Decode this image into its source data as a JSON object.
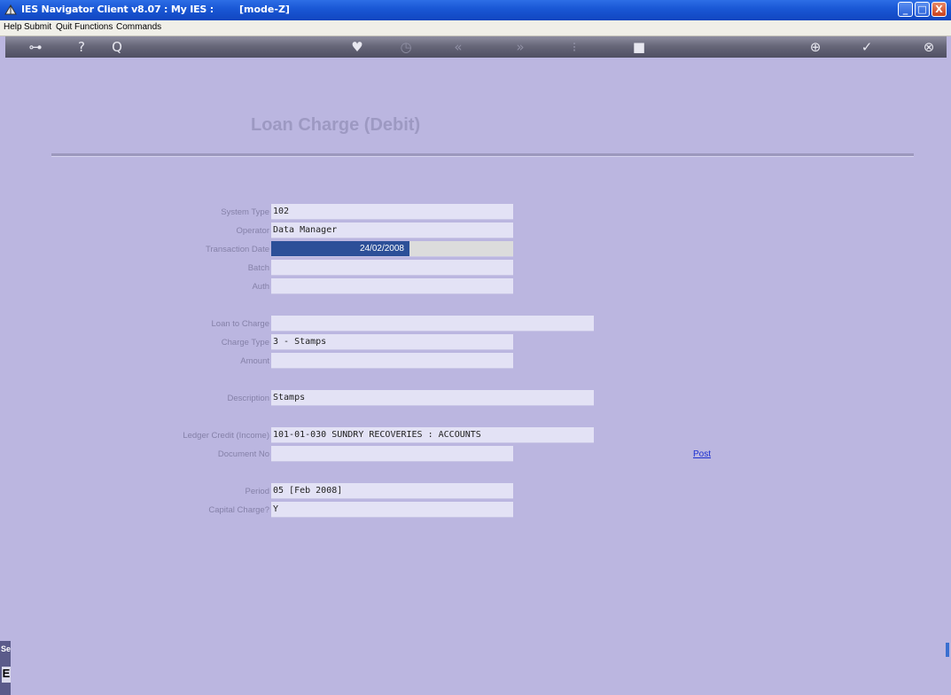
{
  "window": {
    "title": "IES Navigator Client v8.07 : My IES :",
    "mode": "[mode-Z]",
    "minimize": "_",
    "maximize": "□",
    "close": "X"
  },
  "menu": [
    "Help",
    "Submit",
    "Quit",
    "Functions",
    "Commands"
  ],
  "toolbar": {
    "icons": [
      "key-icon",
      "help-icon",
      "search-icon",
      "heart-icon",
      "clock-icon",
      "prev-icon",
      "next-icon",
      "grid-icon",
      "stop-icon",
      "refresh-icon",
      "check-icon",
      "close-icon"
    ],
    "glyphs": {
      "key": "⊶",
      "help": "?",
      "search": "Q",
      "heart": "♥",
      "clock": "◷",
      "prev": "«",
      "next": "»",
      "grid": "⁝",
      "stop": "■",
      "refresh": "⊕",
      "check": "✓",
      "close": "⊗"
    }
  },
  "page": {
    "heading": "Loan Charge (Debit)"
  },
  "form": {
    "system_type": {
      "label": "System Type",
      "value": "102"
    },
    "operator": {
      "label": "Operator",
      "value": "Data Manager"
    },
    "transaction_date": {
      "label": "Transaction Date",
      "value": "24/02/2008"
    },
    "batch": {
      "label": "Batch",
      "value": ""
    },
    "auth": {
      "label": "Auth",
      "value": ""
    },
    "loan_to_charge": {
      "label": "Loan to Charge",
      "value": ""
    },
    "charge_type": {
      "label": "Charge Type",
      "value": "3 - Stamps"
    },
    "amount": {
      "label": "Amount",
      "value": ""
    },
    "description": {
      "label": "Description",
      "value": "Stamps"
    },
    "ledger_credit": {
      "label": "Ledger Credit (Income)",
      "value": "101-01-030 SUNDRY RECOVERIES : ACCOUNTS"
    },
    "document_no": {
      "label": "Document No",
      "value": ""
    },
    "period": {
      "label": "Period",
      "value": "05  [Feb 2008]"
    },
    "capital_charge": {
      "label": "Capital Charge?",
      "value": "Y"
    }
  },
  "actions": {
    "post": "Post"
  },
  "side": {
    "tab_label": "Se",
    "glyph": "E"
  },
  "colors": {
    "background": "#bbb6e0",
    "titlebar": "#1a58d6",
    "toolbar": "#5f5f72",
    "field": "#e3e2f5",
    "selection": "#2c4f98",
    "link": "#1a2fd0"
  }
}
